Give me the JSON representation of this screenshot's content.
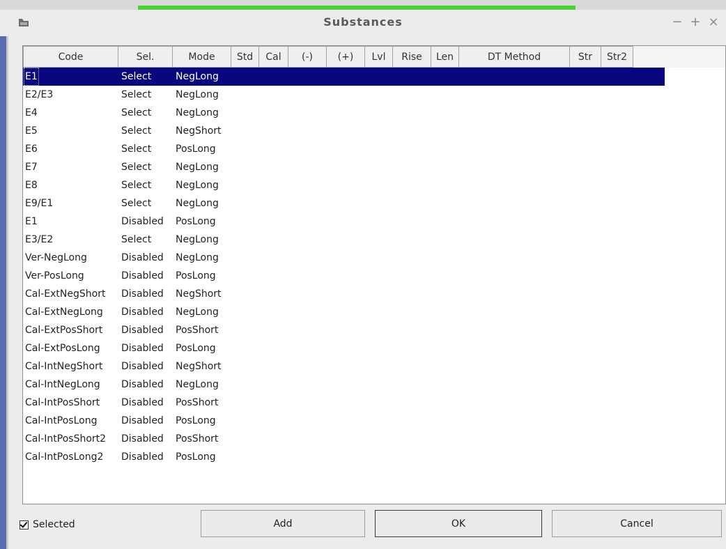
{
  "window": {
    "title": "Substances",
    "controls": {
      "minimize": "−",
      "maximize": "+",
      "close": "×"
    },
    "icon": "app-icon"
  },
  "table": {
    "columns": [
      "Code",
      "Sel.",
      "Mode",
      "Std",
      "Cal",
      "(-)",
      "(+)",
      "Lvl",
      "Rise",
      "Len",
      "DT Method",
      "Str",
      "Str2"
    ],
    "selected_row": 0,
    "rows": [
      {
        "code": "E1",
        "sel": "Select",
        "mode": "NegLong"
      },
      {
        "code": "E2/E3",
        "sel": "Select",
        "mode": "NegLong"
      },
      {
        "code": "E4",
        "sel": "Select",
        "mode": "NegLong"
      },
      {
        "code": "E5",
        "sel": "Select",
        "mode": "NegShort"
      },
      {
        "code": "E6",
        "sel": "Select",
        "mode": "PosLong"
      },
      {
        "code": "E7",
        "sel": "Select",
        "mode": "NegLong"
      },
      {
        "code": "E8",
        "sel": "Select",
        "mode": "NegLong"
      },
      {
        "code": "E9/E1",
        "sel": "Select",
        "mode": "NegLong"
      },
      {
        "code": "E1",
        "sel": "Disabled",
        "mode": "PosLong"
      },
      {
        "code": "E3/E2",
        "sel": "Select",
        "mode": "NegLong"
      },
      {
        "code": "Ver-NegLong",
        "sel": "Disabled",
        "mode": "NegLong"
      },
      {
        "code": "Ver-PosLong",
        "sel": "Disabled",
        "mode": "PosLong"
      },
      {
        "code": "Cal-ExtNegShort",
        "sel": "Disabled",
        "mode": "NegShort"
      },
      {
        "code": "Cal-ExtNegLong",
        "sel": "Disabled",
        "mode": "NegLong"
      },
      {
        "code": "Cal-ExtPosShort",
        "sel": "Disabled",
        "mode": "PosShort"
      },
      {
        "code": "Cal-ExtPosLong",
        "sel": "Disabled",
        "mode": "PosLong"
      },
      {
        "code": "Cal-IntNegShort",
        "sel": "Disabled",
        "mode": "NegShort"
      },
      {
        "code": "Cal-IntNegLong",
        "sel": "Disabled",
        "mode": "NegLong"
      },
      {
        "code": "Cal-IntPosShort",
        "sel": "Disabled",
        "mode": "PosShort"
      },
      {
        "code": "Cal-IntPosLong",
        "sel": "Disabled",
        "mode": "PosLong"
      },
      {
        "code": "Cal-IntPosShort2",
        "sel": "Disabled",
        "mode": "PosShort"
      },
      {
        "code": "Cal-IntPosLong2",
        "sel": "Disabled",
        "mode": "PosLong"
      }
    ]
  },
  "footer": {
    "checkbox_label": "Selected",
    "checkbox_checked": true,
    "add_label": "Add",
    "ok_label": "OK",
    "cancel_label": "Cancel"
  },
  "colors": {
    "selection": "#07067e",
    "accent_bar": "#4cd13a",
    "left_edge": "#5b6bb0"
  }
}
